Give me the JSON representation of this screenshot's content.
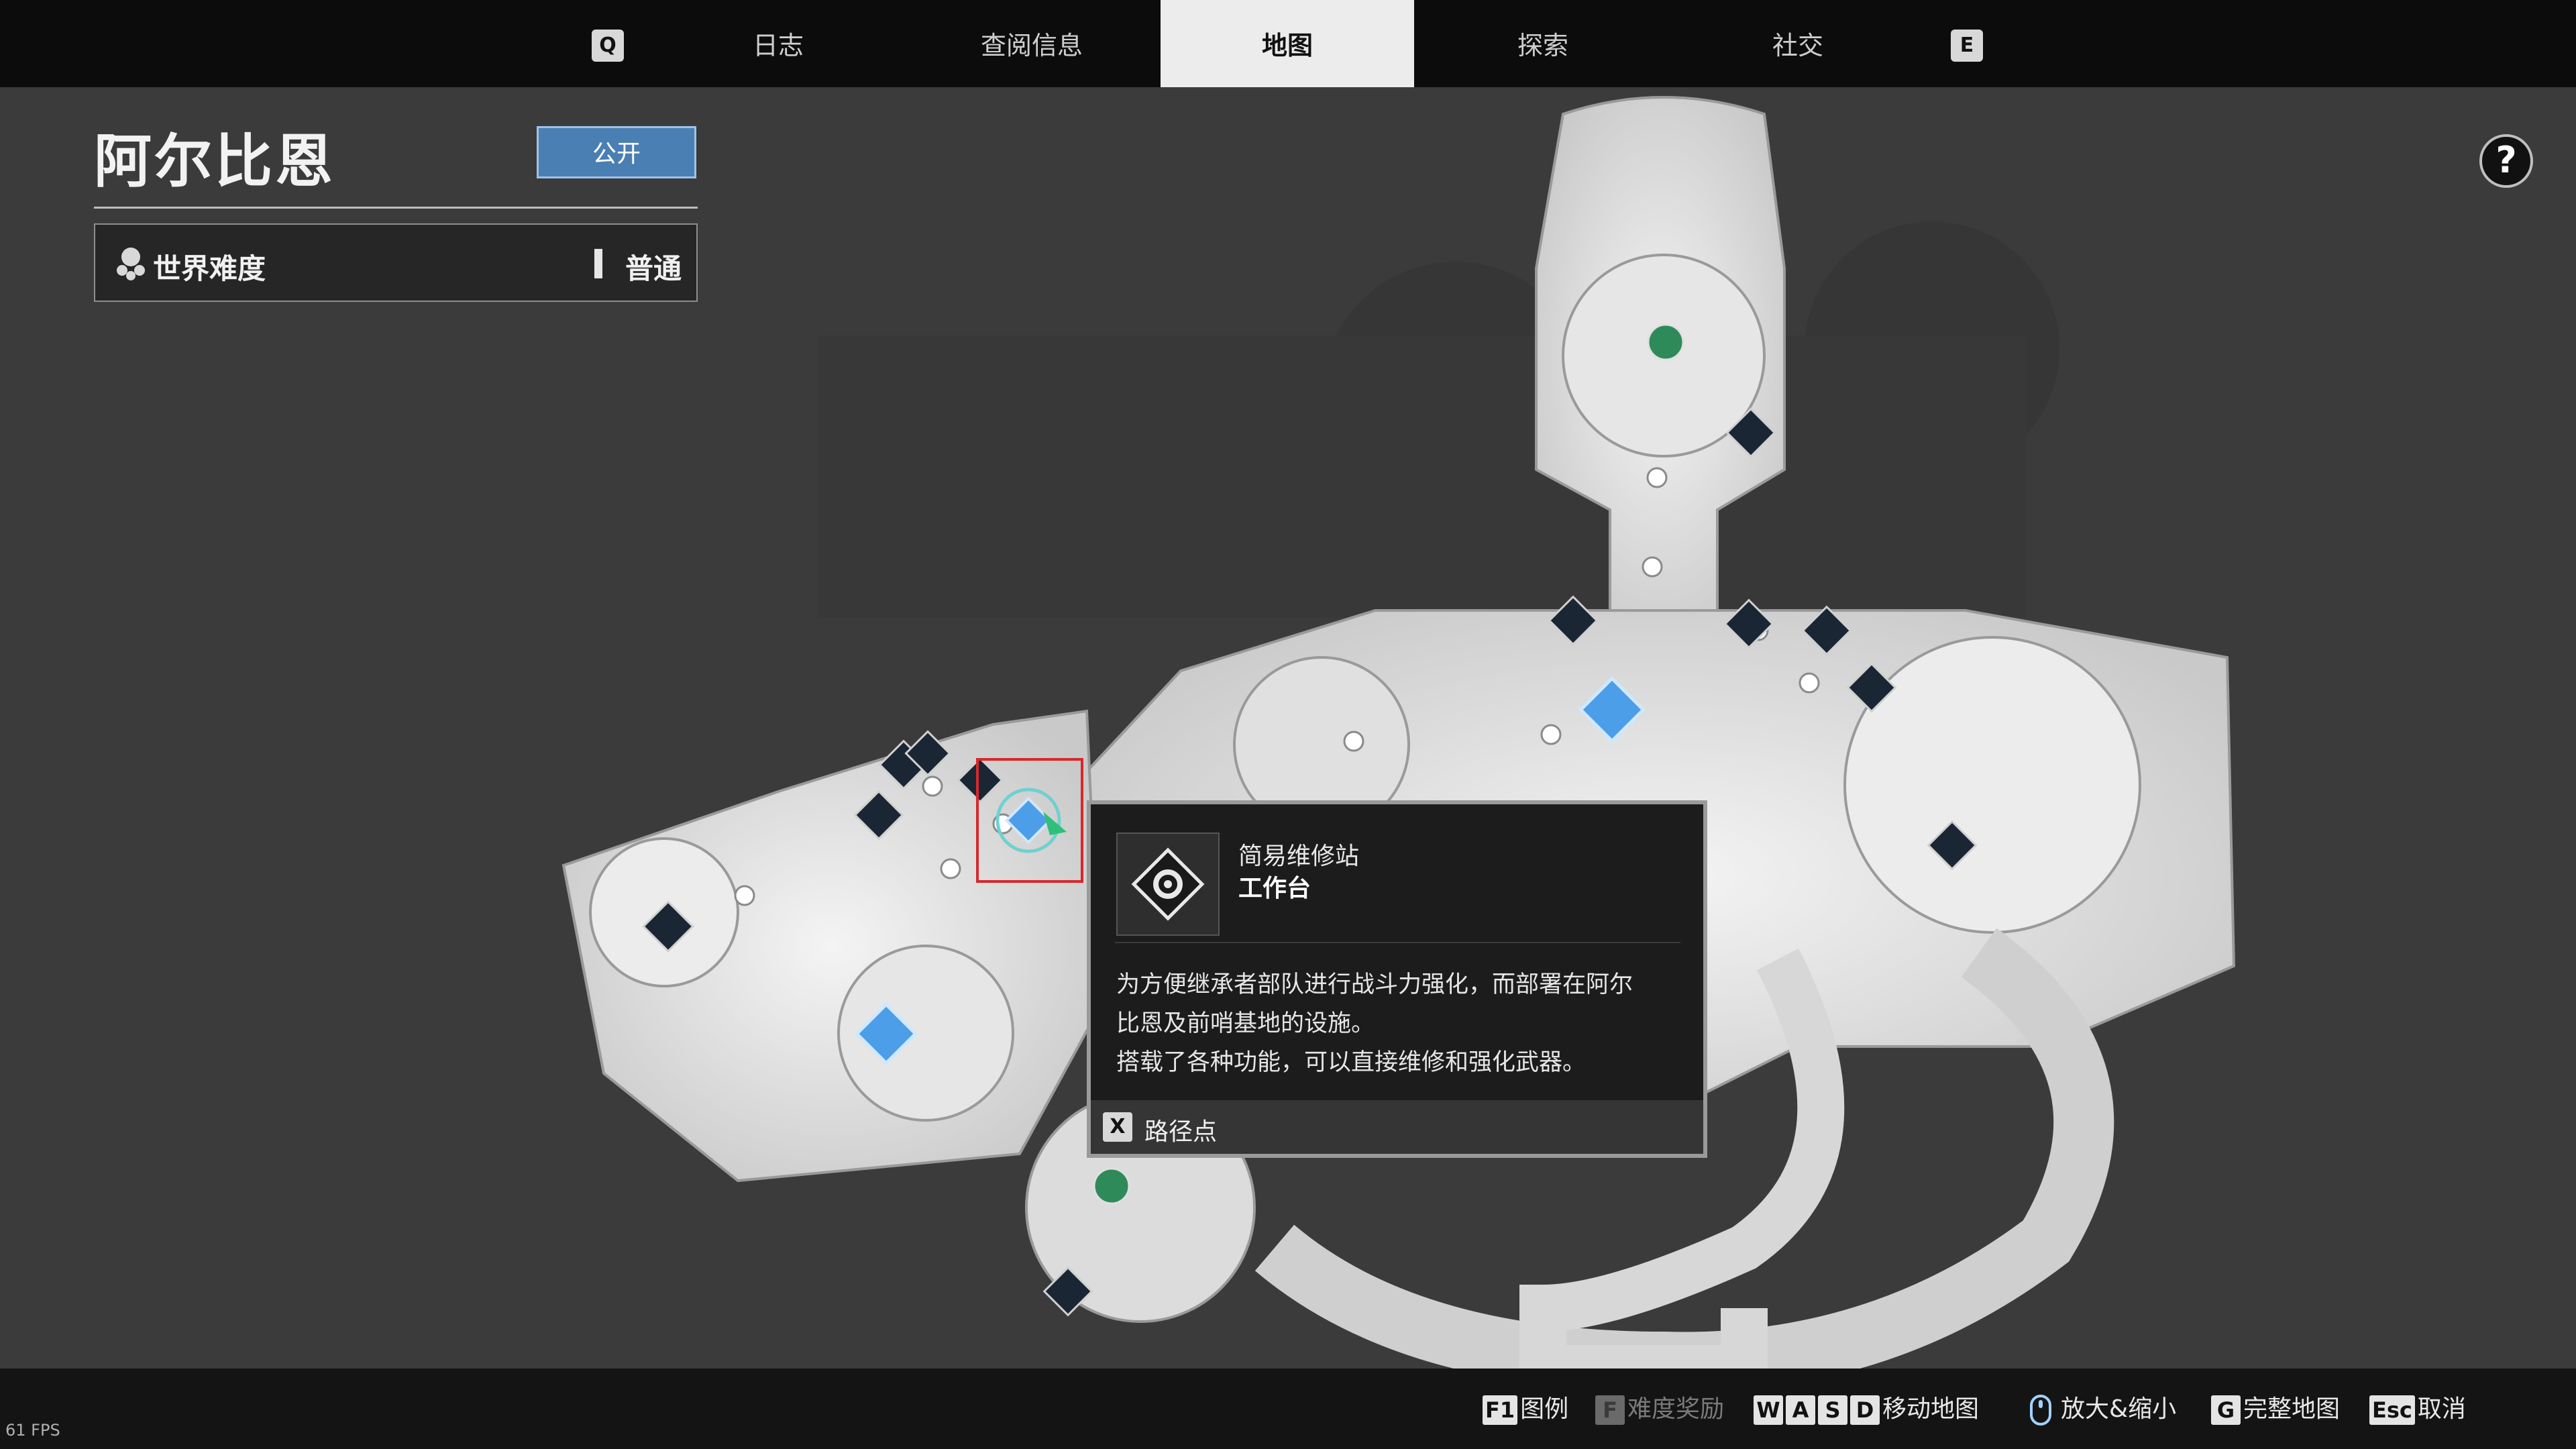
{
  "tabs": {
    "left_key": "Q",
    "right_key": "E",
    "items": [
      {
        "label": "日志"
      },
      {
        "label": "查阅信息"
      },
      {
        "label": "地图"
      },
      {
        "label": "探索"
      },
      {
        "label": "社交"
      }
    ],
    "active_index": 2
  },
  "panel": {
    "title": "阿尔比恩",
    "public_button": "公开",
    "difficulty_label": "世界难度",
    "difficulty_value": "普通"
  },
  "help_icon": "?",
  "tooltip": {
    "category": "简易维修站",
    "name": "工作台",
    "icon": "gear-wrench-icon",
    "description_lines": [
      "为方便继承者部队进行战斗力强化，而部署在阿尔",
      "比恩及前哨基地的设施。",
      "搭载了各种功能，可以直接维修和强化武器。"
    ],
    "action_key": "X",
    "action_label": "路径点"
  },
  "hints": [
    {
      "key": "F1",
      "label": "图例",
      "enabled": true
    },
    {
      "key": "F",
      "label": "难度奖励",
      "enabled": false
    },
    {
      "keys": [
        "W",
        "A",
        "S",
        "D"
      ],
      "label": "移动地图",
      "enabled": true
    },
    {
      "icon": "mouse-scroll-icon",
      "label": "放大&缩小",
      "enabled": true
    },
    {
      "key": "G",
      "label": "完整地图",
      "enabled": true
    },
    {
      "key": "Esc",
      "label": "取消",
      "enabled": true
    }
  ],
  "fps": "61 FPS",
  "colors": {
    "accent_blue": "#4a7fb3",
    "marker_blue": "#6fb4f0",
    "marker_green": "#2f8a5a",
    "selection_red": "#d9272b",
    "background": "#3b3b3b"
  }
}
